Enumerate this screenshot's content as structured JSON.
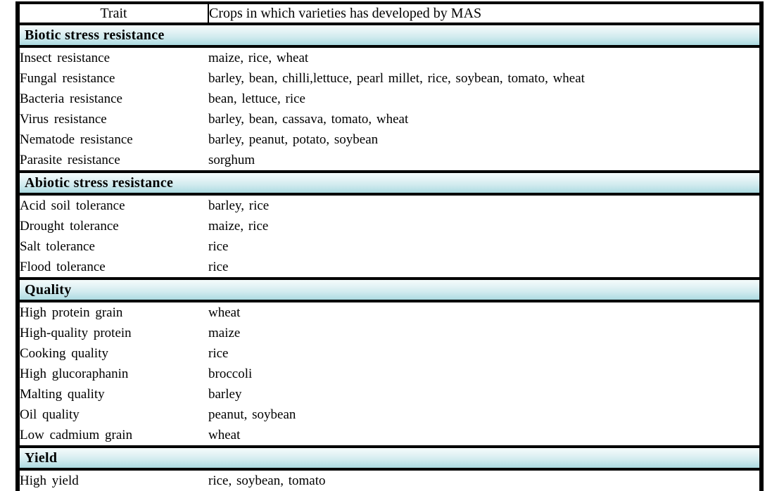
{
  "table": {
    "columns": [
      {
        "key": "trait",
        "label": "Trait"
      },
      {
        "key": "crops",
        "label": "Crops in which varieties has developed by MAS"
      }
    ],
    "colors": {
      "section_gradient_top": "#f4fbfb",
      "section_gradient_bottom": "#a9d8df",
      "border": "#000000",
      "background": "#ffffff",
      "text": "#000000"
    },
    "sections": [
      {
        "title": "Biotic stress resistance",
        "rows": [
          {
            "trait": "Insect resistance",
            "crops": "maize, rice, wheat"
          },
          {
            "trait": "Fungal resistance",
            "crops": "barley, bean, chilli,lettuce, pearl millet, rice, soybean, tomato, wheat"
          },
          {
            "trait": "Bacteria resistance",
            "crops": "bean, lettuce, rice"
          },
          {
            "trait": "Virus resistance",
            "crops": "barley, bean, cassava, tomato, wheat"
          },
          {
            "trait": "Nematode resistance",
            "crops": "barley, peanut, potato, soybean"
          },
          {
            "trait": "Parasite resistance",
            "crops": "sorghum"
          }
        ]
      },
      {
        "title": "Abiotic stress resistance",
        "rows": [
          {
            "trait": "Acid soil tolerance",
            "crops": "barley, rice"
          },
          {
            "trait": "Drought tolerance",
            "crops": "maize, rice"
          },
          {
            "trait": "Salt tolerance",
            "crops": "rice"
          },
          {
            "trait": "Flood tolerance",
            "crops": "rice"
          }
        ]
      },
      {
        "title": "Quality",
        "rows": [
          {
            "trait": "High protein grain",
            "crops": "wheat"
          },
          {
            "trait": "High-quality protein",
            "crops": "maize"
          },
          {
            "trait": "Cooking quality",
            "crops": "rice"
          },
          {
            "trait": "High glucoraphanin",
            "crops": "broccoli"
          },
          {
            "trait": "Malting quality",
            "crops": "barley"
          },
          {
            "trait": "Oil quality",
            "crops": "peanut, soybean"
          },
          {
            "trait": "Low cadmium grain",
            "crops": "wheat"
          }
        ]
      },
      {
        "title": "Yield",
        "rows": [
          {
            "trait": "High yield",
            "crops": "rice, soybean, tomato"
          }
        ]
      }
    ]
  }
}
